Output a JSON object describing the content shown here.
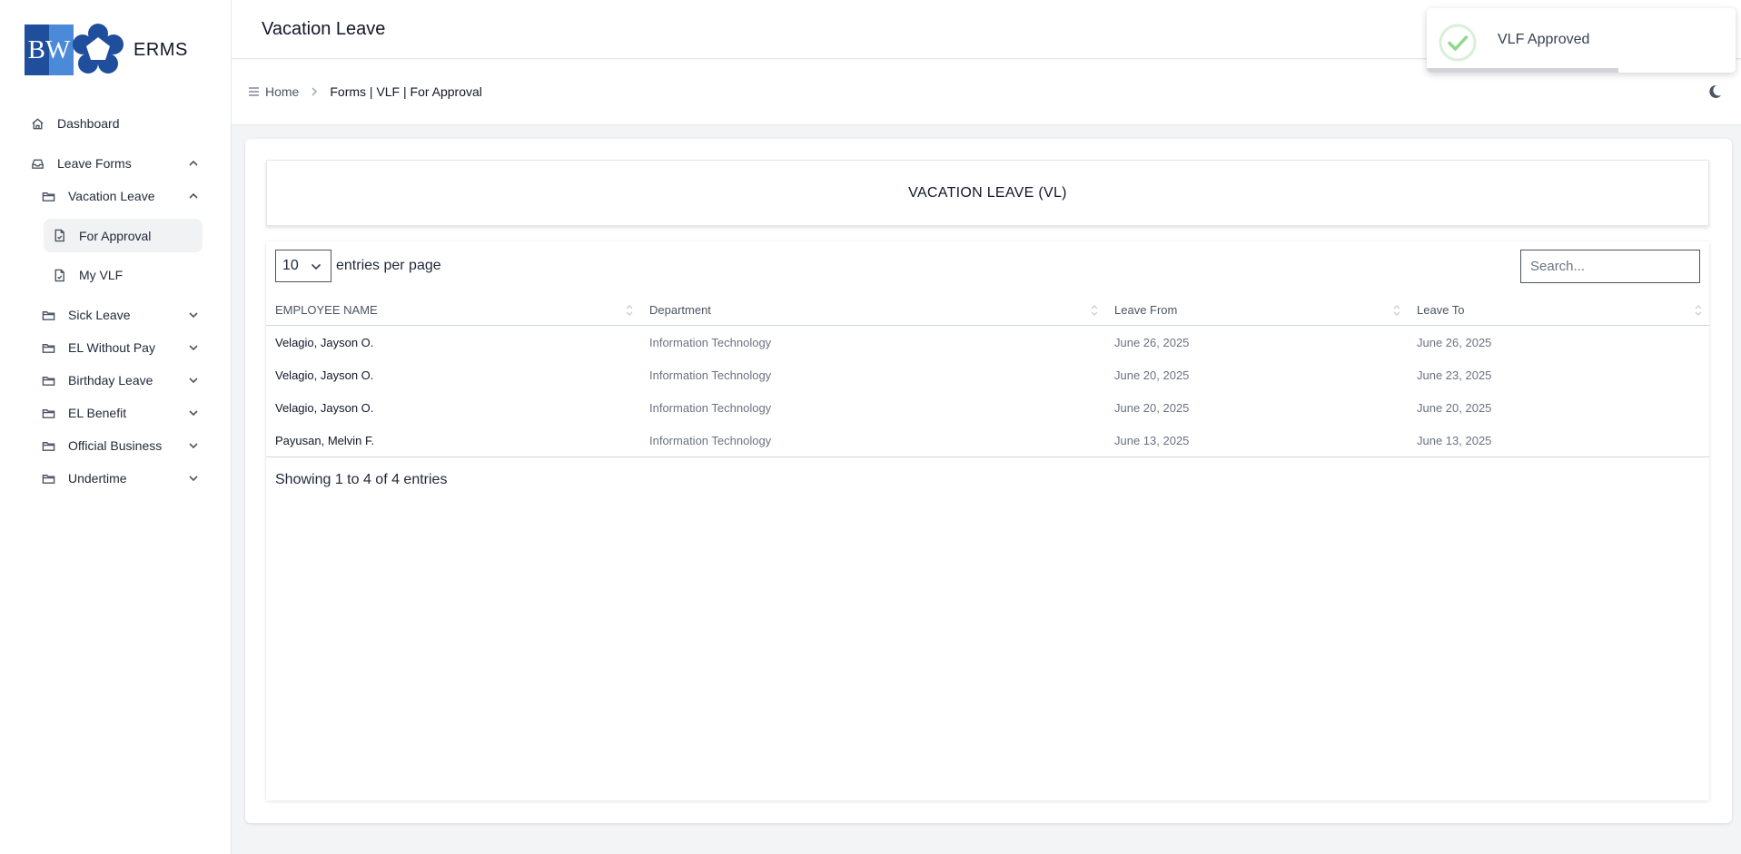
{
  "app": {
    "logo_text": "BW",
    "name": "ERMS"
  },
  "sidebar": {
    "dashboard": "Dashboard",
    "leave_forms": "Leave Forms",
    "vacation_leave": "Vacation Leave",
    "for_approval": "For Approval",
    "my_vlf": "My VLF",
    "sick_leave": "Sick Leave",
    "el_without_pay": "EL Without Pay",
    "birthday_leave": "Birthday Leave",
    "el_benefit": "EL Benefit",
    "official_business": "Official Business",
    "undertime": "Undertime"
  },
  "header": {
    "title": "Vacation Leave"
  },
  "breadcrumb": {
    "home": "Home",
    "current": "Forms | VLF | For Approval"
  },
  "card": {
    "title": "VACATION LEAVE (VL)"
  },
  "table": {
    "per_page": "10",
    "per_page_label": "entries per page",
    "search_placeholder": "Search...",
    "columns": [
      "EMPLOYEE NAME",
      "Department",
      "Leave From",
      "Leave To"
    ],
    "rows": [
      [
        "Velagio, Jayson O.",
        "Information Technology",
        "June 26, 2025",
        "June 26, 2025"
      ],
      [
        "Velagio, Jayson O.",
        "Information Technology",
        "June 20, 2025",
        "June 23, 2025"
      ],
      [
        "Velagio, Jayson O.",
        "Information Technology",
        "June 20, 2025",
        "June 20, 2025"
      ],
      [
        "Payusan, Melvin F.",
        "Information Technology",
        "June 13, 2025",
        "June 13, 2025"
      ]
    ],
    "showing": "Showing 1 to 4 of 4 entries"
  },
  "toast": {
    "message": "VLF Approved",
    "progress": 0.62,
    "color": "#8ed88e"
  },
  "colors": {
    "logo_dark": "#1e4e9c",
    "logo_light": "#4a8ad8",
    "background": "#f3f4f6"
  }
}
